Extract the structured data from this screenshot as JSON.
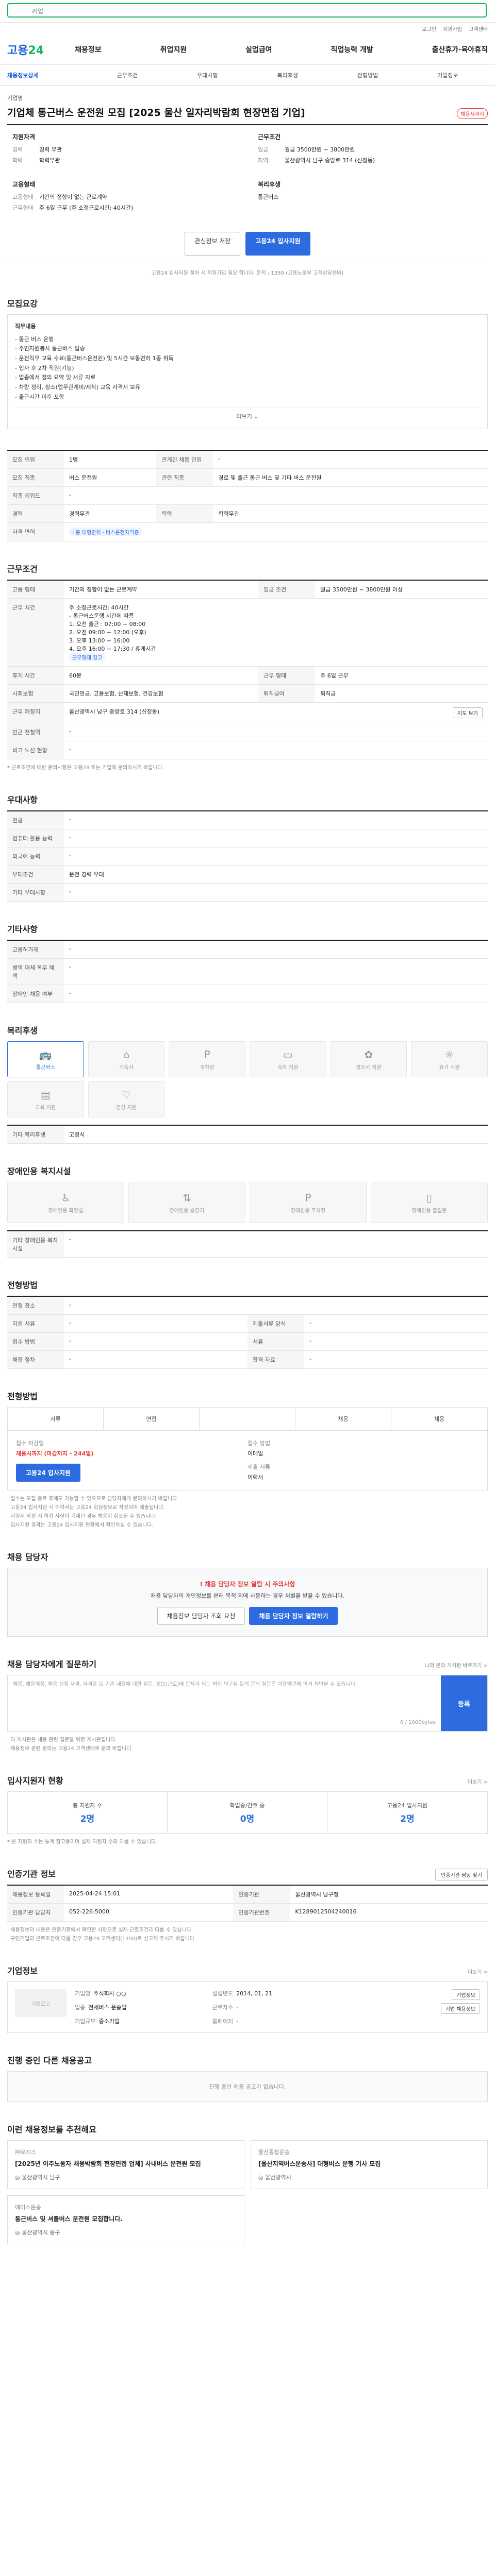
{
  "top": {
    "search_placeholder": "기업",
    "util": [
      "로그인",
      "회원가입",
      "고객센터"
    ]
  },
  "gnb": {
    "logo_a": "고용",
    "logo_b": "24",
    "menu": [
      "채용정보",
      "취업지원",
      "실업급여",
      "직업능력 개발",
      "출산휴가·육아휴직"
    ]
  },
  "tabs": [
    "채용정보상세",
    "근무조건",
    "우대사항",
    "복리후생",
    "전형방법",
    "기업정보"
  ],
  "job": {
    "company": "기업명",
    "title": "기업체 통근버스 운전원 모집 [2025 울산 일자리박람회 현장면접 기업]",
    "badge": "채용시까지",
    "req_title": "지원자격",
    "req": [
      {
        "k": "경력",
        "v": "경력 무관"
      },
      {
        "k": "학력",
        "v": "학력무관"
      }
    ],
    "cond_title": "근무조건",
    "cond": [
      {
        "k": "임금",
        "v": "월급 3500만원 ~ 3800만원"
      },
      {
        "k": "지역",
        "v": "울산광역시 남구 중앙로 314 (신정동)"
      }
    ],
    "emp_title": "고용형태",
    "emp": [
      {
        "k": "고용형태",
        "v": "기간의 정함이 없는 근로계약"
      },
      {
        "k": "근무형태",
        "v": "주 6일 근무 (주 소정근로시간: 40시간)"
      }
    ],
    "welfare_title": "복리후생",
    "welfare_text": "통근버스",
    "btn_scrap": "관심정보 저장",
    "btn_apply": "고용24 입사지원",
    "notice": "고용24 입사지원 절차 시 회원가입 필요 합니다. 문의 : 1350 (고용노동부 고객상담센터)"
  },
  "detail": {
    "title": "모집요강",
    "duty_head": "직무내용",
    "duty": [
      "- 통근 버스 운행",
      "- 주민자원봉사 통근버스 탑승",
      "- 운전직무 교육 수료(통근버스운전원) 및 5시간 보통면허 1종 취득",
      "- 입사 후 2차 직원(기능)",
      "- 업종에서 정의 요약 및 서류 자료",
      "- 차량 정리, 청소(업무관계비/세척) 교육 자격서 보유",
      "- 출근시간 이후 포함"
    ],
    "more": "더보기 ⌄"
  },
  "recruit": {
    "rows": [
      [
        {
          "k": "모집 인원",
          "v": "1명"
        },
        {
          "k": "관계된 채용 인원",
          "v": "-"
        }
      ],
      [
        {
          "k": "모집 직종",
          "v": "버스 운전원"
        },
        {
          "k": "관련 직종",
          "v": "경로 및 출근 통근 버스 및 기타 버스 운전원"
        }
      ],
      [
        {
          "k": "직종 키워드",
          "v": "-"
        },
        {
          "k": "",
          "v": ""
        }
      ],
      [
        {
          "k": "경력",
          "v": "경력무관"
        },
        {
          "k": "학력",
          "v": "학력무관"
        }
      ],
      [
        {
          "k": "자격 면허",
          "v": "1종 대형면허 · 버스운전자격증"
        },
        {
          "k": "",
          "v": ""
        }
      ]
    ]
  },
  "work": {
    "title": "근무조건",
    "contract_k": "고용 형태",
    "contract_v": "기간의 정함이 없는 근로계약",
    "wage_k": "임금 조건",
    "wage_v": "월급 3500만원 ~ 3800만원 이상",
    "time_k": "근무 시간",
    "time": [
      "주 소정근로시간: 40시간",
      "- 통근버스운행 시간에 따름",
      "1. 오전 출근 : 07:00 ~ 08:00",
      "2. 오전 09:00 ~ 12:00 (오후)",
      "3. 오후 13:00 ~ 16:00",
      "4. 오후 16:00 ~ 17:30 / 휴게시간"
    ],
    "time_chip": "근무형태 참고",
    "rows": [
      [
        {
          "k": "휴게 시간",
          "v": "60분"
        },
        {
          "k": "근무 형태",
          "v": "주 6일 근무"
        }
      ],
      [
        {
          "k": "사회보험",
          "v": "국민연금, 고용보험, 산재보험, 건강보험"
        },
        {
          "k": "퇴직급여",
          "v": "퇴직금"
        }
      ],
      [
        {
          "k": "근무 예정지",
          "v": "울산광역시 남구 중앙로 314 (신정동)"
        },
        {
          "k": "",
          "v": ""
        }
      ],
      [
        {
          "k": "인근 전철역",
          "v": "-"
        },
        {
          "k": "",
          "v": ""
        }
      ],
      [
        {
          "k": "비고 노선 현황",
          "v": "-"
        },
        {
          "k": "",
          "v": ""
        }
      ]
    ],
    "map_btn": "지도 보기",
    "note": "* 근로조건에 대한 문의사항은 고용24 또는 기업에 문의하시기 바랍니다."
  },
  "pref": {
    "title": "우대사항",
    "rows": [
      {
        "k": "전공",
        "v": "-"
      },
      {
        "k": "컴퓨터 활용 능력",
        "v": "-"
      },
      {
        "k": "외국어 능력",
        "v": "-"
      },
      {
        "k": "우대조건",
        "v": "운전 경력 우대"
      },
      {
        "k": "기타 우대사항",
        "v": "-"
      }
    ]
  },
  "etc": {
    "title": "기타사항",
    "rows": [
      {
        "k": "고용허가제",
        "v": "-"
      },
      {
        "k": "병역 대체 복무 혜택",
        "v": "-"
      },
      {
        "k": "장애인 채용 여부",
        "v": "-"
      }
    ]
  },
  "benefit": {
    "title": "복리후생",
    "items": [
      {
        "label": "통근버스",
        "on": true
      },
      {
        "label": "기숙사",
        "on": false
      },
      {
        "label": "주차장",
        "on": false
      },
      {
        "label": "숙박 지원",
        "on": false
      },
      {
        "label": "경조사 지원",
        "on": false
      },
      {
        "label": "휴가 지원",
        "on": false
      },
      {
        "label": "교육 지원",
        "on": false
      },
      {
        "label": "건강 지원",
        "on": false
      }
    ],
    "other_head": "기타 복리후생",
    "other_val": "고정식"
  },
  "disab": {
    "title": "장애인용 복지시설",
    "items": [
      "장애인용 화장실",
      "장애인용 승강기",
      "장애인용 주차장",
      "장애인용 출입문"
    ],
    "other_head": "기타 장애인용 복지시설",
    "other_val": "-"
  },
  "select": {
    "title": "전형방법",
    "rows": [
      [
        {
          "k": "전형 장소",
          "v": "-"
        },
        {
          "k": "",
          "v": ""
        }
      ],
      [
        {
          "k": "지원 서류",
          "v": "-"
        },
        {
          "k": "제출서류 양식",
          "v": "-"
        }
      ],
      [
        {
          "k": "접수 방법",
          "v": "-"
        },
        {
          "k": "서류",
          "v": "-"
        }
      ],
      [
        {
          "k": "채용 절차",
          "v": "-"
        },
        {
          "k": "합격 자료",
          "v": "-"
        }
      ]
    ]
  },
  "process": {
    "title": "전형방법",
    "steps": [
      "서류",
      "면접",
      "",
      "채용",
      "채용"
    ],
    "apply_k": "접수 마감일",
    "apply_v": "채용시까지 (마감까지 - 244일)",
    "method_k": "접수 방법",
    "method_v": "이메일",
    "doc_k": "제출 서류",
    "doc_v": "이력서",
    "btn": "고용24 입사지원",
    "notes": [
      "· 접수는 모집 종료 후에도 가능할 수 있으므로 담당자에게 문의하시기 바랍니다.",
      "· 고용24 입사지원 시 이력서는 고용24 회원정보로 작성되어 제출됩니다.",
      "· 지원서 작성 시 허위 사실이 기재된 경우 채용이 취소될 수 있습니다.",
      "· 입사지원 결과는 고용24 입사지원 현황에서 확인하실 수 있습니다."
    ]
  },
  "manager": {
    "title": "채용 담당자",
    "warn": "! 채용 담당자 정보 열람 시 주의사항",
    "desc": "채용 담당자의 개인정보를 본래 목적 외에 사용하는 경우 처벌을 받을 수 있습니다.",
    "btn_a": "채용정보 담당자 조회 요청",
    "btn_b": "채용 담당자 정보 열람하기"
  },
  "qna": {
    "title": "채용 담당자에게 질문하기",
    "right": "나의 문의 게시판 바로가기 >",
    "placeholder": "채용, 채용예정, 채용 신청 자격, 자격증 등 기존 내용에 대한 질문, 정보(근로)에 문제가 되는 허위 의구점 등의 문의 질문은 이용약관에 의거 차단될 수 있습니다.",
    "count": "0 / 1000bytes",
    "send": "등록",
    "notes": [
      "· 이 게시판은 채용 관련 질문을 위한 게시판입니다.",
      "· 채용정보 관련 문의는 고용24 고객센터로 문의 바랍니다."
    ]
  },
  "status": {
    "title": "입사지원자 현황",
    "right": "더보기 >",
    "items": [
      {
        "k": "총 지원자 수",
        "v": "2명"
      },
      {
        "k": "학업중/간호 중",
        "v": "0명"
      },
      {
        "k": "고용24 입사지원",
        "v": "2명"
      }
    ],
    "note": "* 본 지원자 수는 통계 참고용이며 실제 지원자 수와 다를 수 있습니다."
  },
  "reg": {
    "title": "인증기관 정보",
    "btn": "인증기관 담당 찾기",
    "rows": [
      [
        {
          "k": "채용정보 등록일",
          "v": "2025-04-24 15:01"
        },
        {
          "k": "인증기관",
          "v": "울산광역시 남구청"
        }
      ],
      [
        {
          "k": "인증기관 담당자",
          "v": "052-226-5000"
        },
        {
          "k": "인증기관번호",
          "v": "K1289012504240016"
        }
      ]
    ],
    "notes": [
      "· 채용정보의 내용은 인증기관에서 확인한 사항으로 실제 근로조건과 다를 수 있습니다.",
      "· 구인기업의 근로조건이 다를 경우 고용24 고객센터(1350)로 신고해 주시기 바랍니다."
    ]
  },
  "company": {
    "title": "기업정보",
    "right": "더보기 >",
    "logo": "기업로고",
    "cols": [
      {
        "k": "기업명",
        "v": "주식회사 ○○"
      },
      {
        "k": "설립년도",
        "v": "2014, 01, 21"
      },
      {
        "k": "업종",
        "v": "전세버스 운송업"
      },
      {
        "k": "근로자수",
        "v": "-"
      },
      {
        "k": "기업규모",
        "v": "중소기업"
      },
      {
        "k": "홈페이지",
        "v": "-"
      }
    ],
    "btns": [
      "기업정보",
      "기업 채용정보"
    ]
  },
  "other": {
    "title": "진행 중인 다른 채용공고",
    "empty": "진행 중인 채용 공고가 없습니다."
  },
  "recs": {
    "title": "이런 채용정보를 추천해요",
    "items": [
      {
        "c": "㈜로지스",
        "t": "[2025년 이주노동자 채용박람회 현장면접 업체] 사내버스 운전원 모집",
        "m": "◎ 울산광역시 남구"
      },
      {
        "c": "울산종합운송",
        "t": "[울산지역버스운송사] 대형버스 운행 기사 모집",
        "m": "◎ 울산광역시"
      },
      {
        "c": "에이스운송",
        "t": "통근버스 및 셔틀버스 운전원 모집합니다.",
        "m": "◎ 울산광역시 중구"
      }
    ]
  }
}
